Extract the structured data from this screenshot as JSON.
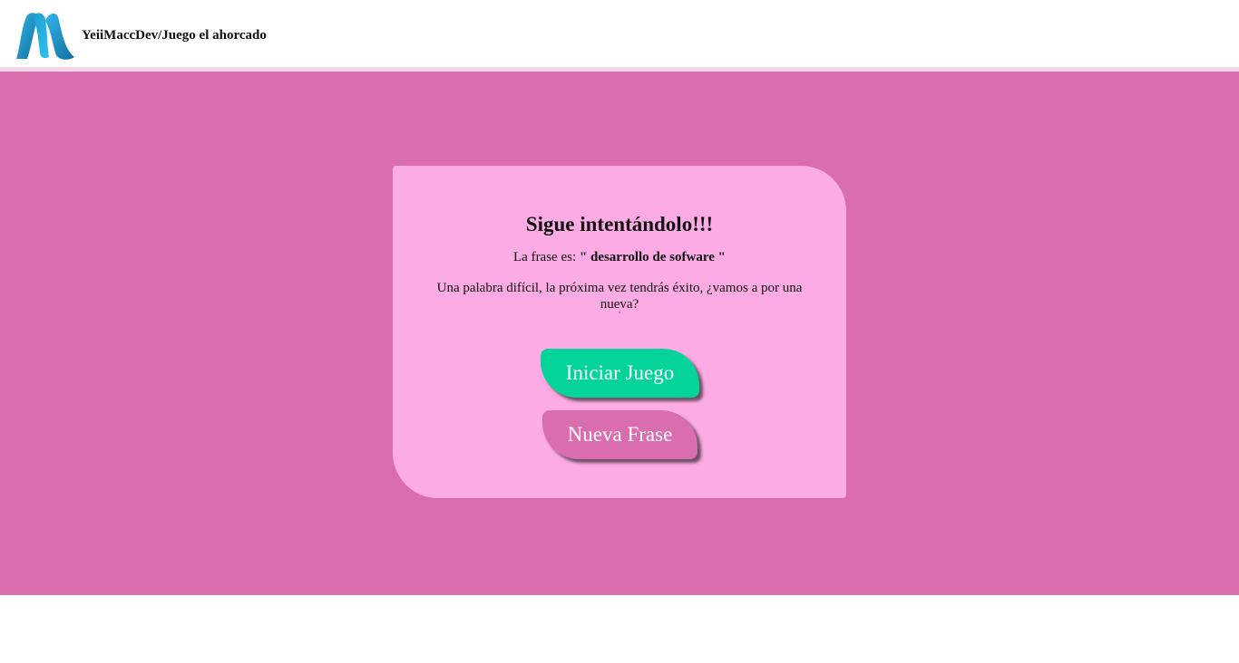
{
  "header": {
    "brand": "YeiiMaccDev/Juego el ahorcado",
    "logo_icon": "m-ribbon-logo-icon",
    "logo_colors": [
      "#1b9bd0",
      "#33b5e8",
      "#0f6f9e"
    ]
  },
  "colors": {
    "stage_background": "#d96dad",
    "card_background": "#fdabe4",
    "start_button": "#04d49a",
    "new_phrase_button": "#d96dad"
  },
  "card": {
    "title": "Sigue intentándolo!!!",
    "phrase_prefix": "La frase es:",
    "phrase_value": "\" desarrollo de sofware \"",
    "message": "Una palabra difícil, la próxima vez tendrás éxito, ¿vamos a por una nueva?",
    "stray_mark": "'"
  },
  "buttons": {
    "start_label": "Iniciar Juego",
    "new_phrase_label": "Nueva Frase"
  }
}
